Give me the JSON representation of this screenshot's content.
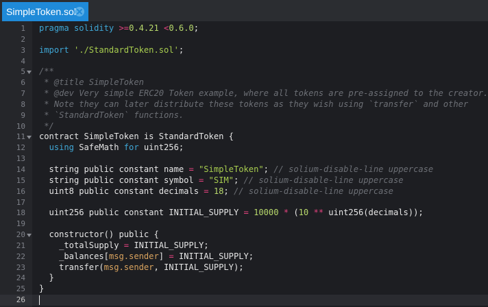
{
  "tab": {
    "title": "SimpleToken.sol",
    "close_icon": "close-icon"
  },
  "colors": {
    "tab_active": "#1f8ad8",
    "keyword": "#3fa7d6",
    "operator": "#e2427e",
    "string": "#a8cd4f",
    "comment": "#6c6f75",
    "builtin": "#d9a35e"
  },
  "cursor": {
    "line": 26
  },
  "lines": [
    {
      "n": "1",
      "fold": false,
      "tokens": [
        [
          "k",
          "pragma solidity"
        ],
        [
          "",
          ""
        ],
        [
          "op",
          " >="
        ],
        [
          "n",
          "0.4.21"
        ],
        [
          "",
          ""
        ],
        [
          "op",
          " <"
        ],
        [
          "n",
          "0.6.0"
        ],
        [
          "",
          ";"
        ]
      ]
    },
    {
      "n": "2",
      "fold": false,
      "tokens": []
    },
    {
      "n": "3",
      "fold": false,
      "tokens": [
        [
          "k",
          "import"
        ],
        [
          "",
          ""
        ],
        [
          "s",
          " './StandardToken.sol'"
        ],
        [
          "",
          ";"
        ]
      ]
    },
    {
      "n": "4",
      "fold": false,
      "tokens": []
    },
    {
      "n": "5",
      "fold": true,
      "tokens": [
        [
          "c",
          "/**"
        ]
      ]
    },
    {
      "n": "6",
      "fold": false,
      "tokens": [
        [
          "c",
          " * @title SimpleToken"
        ]
      ]
    },
    {
      "n": "7",
      "fold": false,
      "tokens": [
        [
          "c",
          " * @dev Very simple ERC20 Token example, where all tokens are pre-assigned to the creator."
        ]
      ]
    },
    {
      "n": "8",
      "fold": false,
      "tokens": [
        [
          "c",
          " * Note they can later distribute these tokens as they wish using `transfer` and other"
        ]
      ]
    },
    {
      "n": "9",
      "fold": false,
      "tokens": [
        [
          "c",
          " * `StandardToken` functions."
        ]
      ]
    },
    {
      "n": "10",
      "fold": false,
      "tokens": [
        [
          "c",
          " */"
        ]
      ]
    },
    {
      "n": "11",
      "fold": true,
      "tokens": [
        [
          "",
          "contract SimpleToken is StandardToken {"
        ]
      ]
    },
    {
      "n": "12",
      "fold": false,
      "tokens": [
        [
          "",
          "  "
        ],
        [
          "k",
          "using"
        ],
        [
          "",
          " SafeMath "
        ],
        [
          "k",
          "for"
        ],
        [
          "",
          " uint256;"
        ]
      ]
    },
    {
      "n": "13",
      "fold": false,
      "tokens": []
    },
    {
      "n": "14",
      "fold": false,
      "tokens": [
        [
          "",
          "  string public constant name "
        ],
        [
          "op",
          "="
        ],
        [
          "s",
          " \"SimpleToken\""
        ],
        [
          "",
          "; "
        ],
        [
          "c",
          "// solium-disable-line uppercase"
        ]
      ]
    },
    {
      "n": "15",
      "fold": false,
      "tokens": [
        [
          "",
          "  string public constant symbol "
        ],
        [
          "op",
          "="
        ],
        [
          "s",
          " \"SIM\""
        ],
        [
          "",
          "; "
        ],
        [
          "c",
          "// solium-disable-line uppercase"
        ]
      ]
    },
    {
      "n": "16",
      "fold": false,
      "tokens": [
        [
          "",
          "  uint8 public constant decimals "
        ],
        [
          "op",
          "="
        ],
        [
          "n",
          " 18"
        ],
        [
          "",
          "; "
        ],
        [
          "c",
          "// solium-disable-line uppercase"
        ]
      ]
    },
    {
      "n": "17",
      "fold": false,
      "tokens": []
    },
    {
      "n": "18",
      "fold": false,
      "tokens": [
        [
          "",
          "  uint256 public constant INITIAL_SUPPLY "
        ],
        [
          "op",
          "="
        ],
        [
          "n",
          " 10000"
        ],
        [
          "op",
          " *"
        ],
        [
          "",
          " ("
        ],
        [
          "n",
          "10"
        ],
        [
          "op",
          " **"
        ],
        [
          "",
          " uint256(decimals));"
        ]
      ]
    },
    {
      "n": "19",
      "fold": false,
      "tokens": []
    },
    {
      "n": "20",
      "fold": true,
      "tokens": [
        [
          "",
          "  constructor() public {"
        ]
      ]
    },
    {
      "n": "21",
      "fold": false,
      "tokens": [
        [
          "",
          "    _totalSupply "
        ],
        [
          "op",
          "="
        ],
        [
          "",
          " INITIAL_SUPPLY;"
        ]
      ]
    },
    {
      "n": "22",
      "fold": false,
      "tokens": [
        [
          "",
          "    _balances["
        ],
        [
          "m",
          "msg.sender"
        ],
        [
          "",
          "] "
        ],
        [
          "op",
          "="
        ],
        [
          "",
          " INITIAL_SUPPLY;"
        ]
      ]
    },
    {
      "n": "23",
      "fold": false,
      "tokens": [
        [
          "",
          "    transfer("
        ],
        [
          "m",
          "msg.sender"
        ],
        [
          "",
          ", INITIAL_SUPPLY);"
        ]
      ]
    },
    {
      "n": "24",
      "fold": false,
      "tokens": [
        [
          "",
          "  }"
        ]
      ]
    },
    {
      "n": "25",
      "fold": false,
      "tokens": [
        [
          "",
          "}"
        ]
      ]
    },
    {
      "n": "26",
      "fold": false,
      "tokens": []
    }
  ]
}
